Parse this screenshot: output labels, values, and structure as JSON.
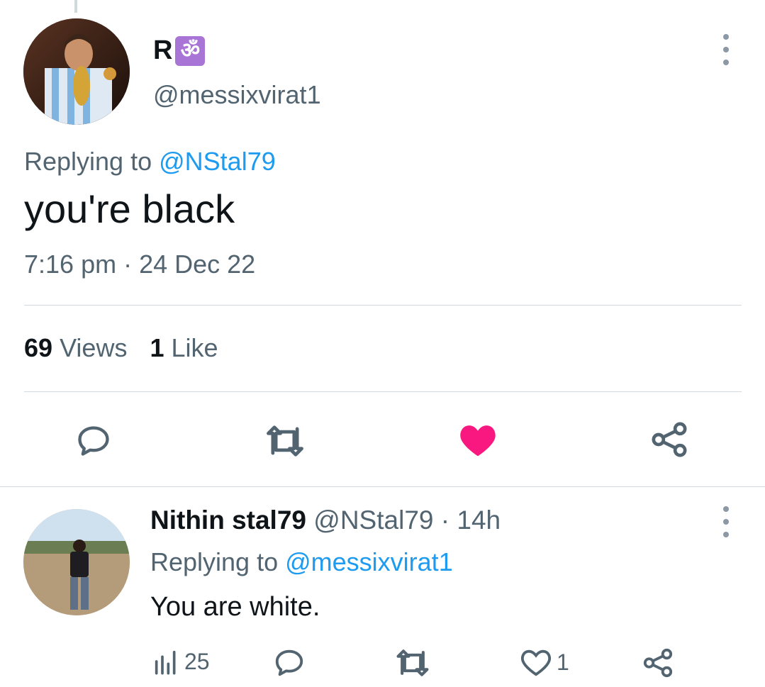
{
  "tweet": {
    "display_name": "R",
    "badge_glyph": "ॐ",
    "handle": "@messixvirat1",
    "replying_prefix": "Replying to",
    "replying_to": "@NStal79",
    "text": "you're black",
    "timestamp": "7:16 pm · 24 Dec 22",
    "stats": {
      "views_count": "69",
      "views_label": "Views",
      "likes_count": "1",
      "likes_label": "Like"
    },
    "liked": true,
    "accent_color": "#f91880"
  },
  "reply": {
    "display_name": "Nithin stal79",
    "handle": "@NStal79",
    "separator": "·",
    "time": "14h",
    "replying_prefix": "Replying to",
    "replying_to": "@messixvirat1",
    "text": "You are white.",
    "views": "25",
    "likes": "1"
  },
  "colors": {
    "link": "#1d9bf0",
    "secondary_text": "#536471",
    "like": "#f91880"
  }
}
